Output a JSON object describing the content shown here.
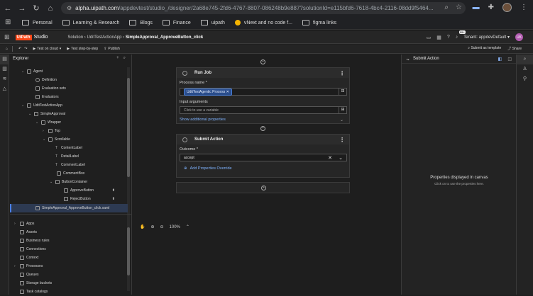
{
  "browser": {
    "url_domain": "alpha.uipath.com",
    "url_rest": "/appdevtest/studio_/designer/2a68e745-2fd6-4767-8807-086248b9e887?solutionId=e115bfd6-7618-4bc4-2116-08dd9f5464..."
  },
  "bookmarks": [
    "Personal",
    "Learning & Research",
    "Blogs",
    "Finance",
    "uipath",
    "vNext and no code f...",
    "figma links"
  ],
  "header": {
    "logo": "UiPath",
    "product": "Studio",
    "crumb_solution": "Solution",
    "crumb_app": "UditTestActionApp",
    "crumb_file": "SimpleApproval_ApproveButton_click",
    "notif_count": "99+",
    "tenant_label": "Tenant:",
    "tenant_value": "appdevDefault",
    "avatar_initials": "UK"
  },
  "toolbar": {
    "test_cloud": "Test on cloud",
    "test_step": "Test step-by-step",
    "publish": "Publish",
    "submit_template": "Submit as template",
    "share": "Share"
  },
  "explorer": {
    "title": "Explorer",
    "tree": [
      "Agent",
      "Definition",
      "Evaluation sets",
      "Evaluators",
      "UditTestActionApp",
      "SimpleApproval",
      "Wrapper",
      "Top",
      "Scrollable",
      "ContentLabel",
      "DetailLabel",
      "CommentLabel",
      "CommentBox",
      "ButtonContainer",
      "ApproveButton",
      "RejectButton",
      "SimpleApproval_ApproveButton_click.xaml"
    ],
    "resources": [
      "Apps",
      "Assets",
      "Business rules",
      "Connections",
      "Context",
      "Processes",
      "Queues",
      "Storage buckets",
      "Task catalogs"
    ]
  },
  "canvas": {
    "run_job": {
      "title": "Run Job",
      "process_label": "Process name *",
      "process_value": "UditTestAgentic Process",
      "input_label": "Input arguments",
      "input_placeholder": "Click to use a variable",
      "show_more": "Show additional properties"
    },
    "submit_action": {
      "title": "Submit Action",
      "outcome_label": "Outcome *",
      "outcome_value": "accept",
      "add_override": "Add Properties Override"
    },
    "zoom": "100%"
  },
  "right_panel": {
    "title": "Submit Action",
    "msg_title": "Properties displayed in canvas",
    "msg_sub": "Click on      to use the properties here."
  }
}
